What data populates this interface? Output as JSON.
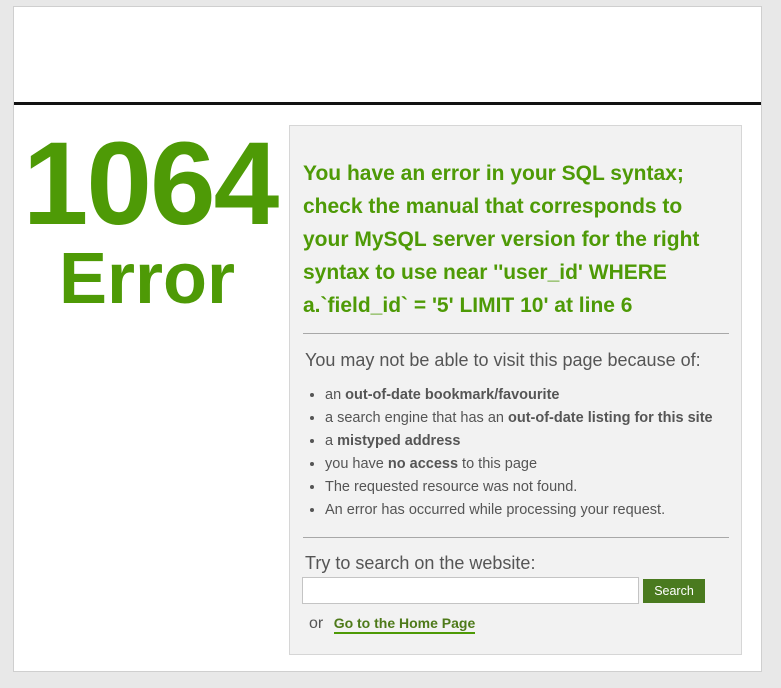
{
  "error": {
    "code": "1064",
    "word": "Error",
    "message": "You have an error in your SQL syntax; check the manual that corresponds to your MySQL server version for the right syntax to use near ''user_id' WHERE a.`field_id` = '5' LIMIT 10' at line 6"
  },
  "reasons": {
    "title": "You may not be able to visit this page because of:",
    "items": [
      {
        "prefix": "an ",
        "bold": "out-of-date bookmark/favourite",
        "suffix": ""
      },
      {
        "prefix": "a search engine that has an ",
        "bold": "out-of-date listing for this site",
        "suffix": ""
      },
      {
        "prefix": "a ",
        "bold": "mistyped address",
        "suffix": ""
      },
      {
        "prefix": "you have ",
        "bold": "no access",
        "suffix": " to this page"
      },
      {
        "prefix": "The requested resource was not found.",
        "bold": "",
        "suffix": ""
      },
      {
        "prefix": "An error has occurred while processing your request.",
        "bold": "",
        "suffix": ""
      }
    ]
  },
  "search": {
    "title": "Try to search on the website:",
    "value": "",
    "placeholder": "",
    "button_label": "Search"
  },
  "home": {
    "or_text": "or",
    "link_label": "Go to the Home Page"
  },
  "colors": {
    "accent_green": "#4e9a06",
    "button_green": "#4a7a1f"
  }
}
